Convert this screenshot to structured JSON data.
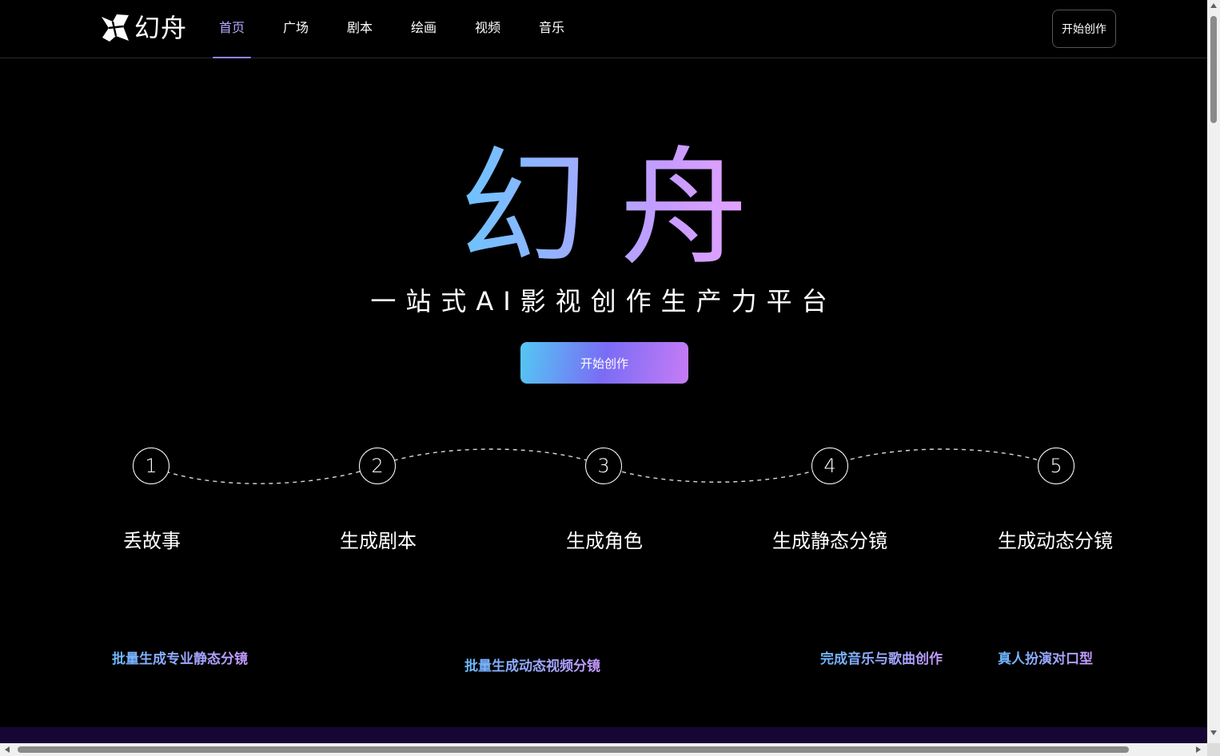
{
  "header": {
    "logo_text": "幻舟",
    "nav": [
      {
        "label": "首页",
        "active": true
      },
      {
        "label": "广场",
        "active": false
      },
      {
        "label": "剧本",
        "active": false
      },
      {
        "label": "绘画",
        "active": false
      },
      {
        "label": "视频",
        "active": false
      },
      {
        "label": "音乐",
        "active": false
      }
    ],
    "cta_label": "开始创作"
  },
  "hero": {
    "title": "幻舟",
    "subtitle": "一站式AI影视创作生产力平台",
    "cta_label": "开始创作"
  },
  "steps": [
    {
      "number": "1",
      "label": "丢故事"
    },
    {
      "number": "2",
      "label": "生成剧本"
    },
    {
      "number": "3",
      "label": "生成角色"
    },
    {
      "number": "4",
      "label": "生成静态分镜"
    },
    {
      "number": "5",
      "label": "生成动态分镜"
    }
  ],
  "features": [
    "批量生成专业静态分镜",
    "批量生成动态视频分镜",
    "完成音乐与歌曲创作",
    "真人扮演对口型"
  ],
  "colors": {
    "accent": "#8e86ff",
    "gradient_start": "#53c8f3",
    "gradient_end": "#c77cf5",
    "background": "#000000"
  }
}
